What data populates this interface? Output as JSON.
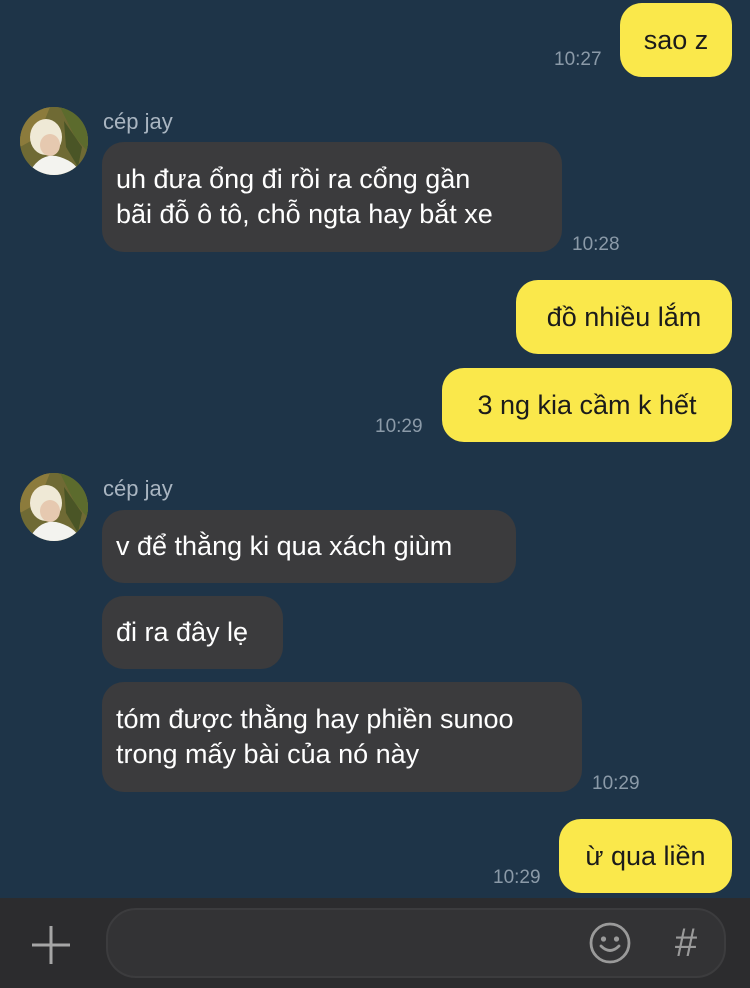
{
  "messages": {
    "m1": {
      "text": "sao z",
      "time": "10:27"
    },
    "g1": {
      "sender": "cép jay",
      "m2": {
        "line1": "uh đưa ổng đi rồi ra cổng gần",
        "line2": "bãi đỗ ô tô, chỗ ngta hay bắt xe"
      },
      "time": "10:28"
    },
    "m3": {
      "text": "đồ nhiều lắm"
    },
    "m4": {
      "text": "3 ng kia cầm k hết",
      "time": "10:29"
    },
    "g2": {
      "sender": "cép jay",
      "m5": {
        "text": "v để thằng ki qua xách giùm"
      },
      "m6": {
        "text": "đi ra đây lẹ"
      },
      "m7": {
        "line1": "tóm được thằng hay phiền sunoo",
        "line2": "trong mấy bài của nó này"
      },
      "time": "10:29"
    },
    "m8": {
      "text": "ừ qua liền",
      "time": "10:29"
    }
  },
  "input_bar": {
    "plus_icon": "plus-icon",
    "emoji_icon": "smiley-icon",
    "hash_symbol": "#",
    "placeholder": ""
  },
  "colors": {
    "background": "#1e3448",
    "incoming_bubble": "#3b3b3d",
    "outgoing_bubble": "#fae84b",
    "input_bar": "#2c2c2e"
  }
}
